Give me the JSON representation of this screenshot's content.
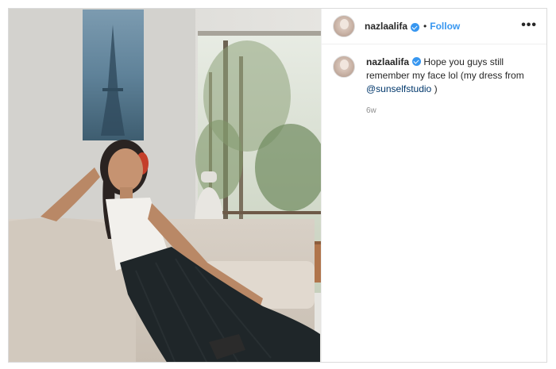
{
  "post": {
    "image_alt": "Woman in white halter top and black pleated skirt reclining on a sofa with eyes closed",
    "author": {
      "username": "nazlaalifa",
      "verified": true
    },
    "header": {
      "separator": "•",
      "follow_label": "Follow",
      "more_label": "•••"
    },
    "caption": {
      "username": "nazlaalifa",
      "text": "Hope you guys still remember my face lol (my dress from",
      "mention": "@sunselfstudio",
      "suffix": ")",
      "timestamp": "6w"
    }
  },
  "colors": {
    "accent": "#3897f0",
    "mention": "#00376b",
    "muted": "#8e8e8e"
  }
}
